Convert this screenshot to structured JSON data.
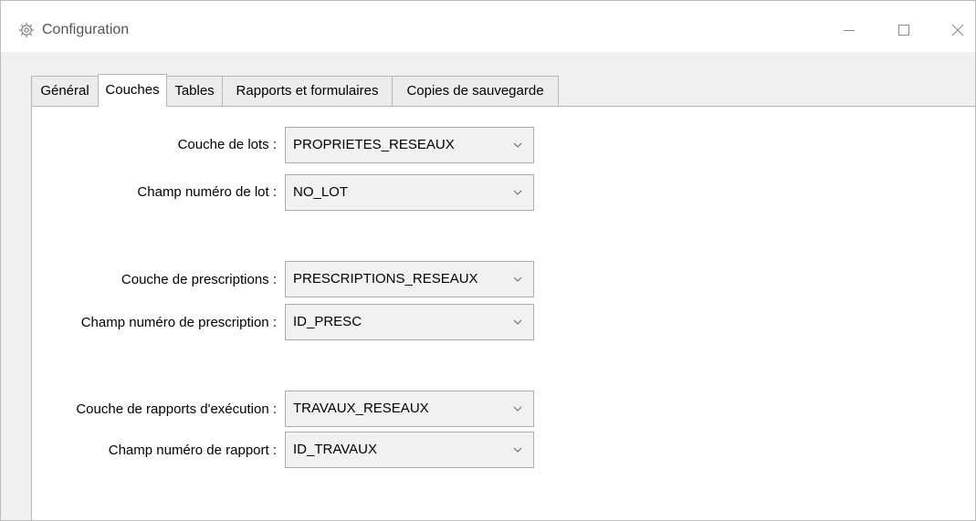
{
  "window": {
    "title": "Configuration",
    "title_icon": "gear-icon"
  },
  "tabs": [
    {
      "label": "Général",
      "active": false
    },
    {
      "label": "Couches",
      "active": true
    },
    {
      "label": "Tables",
      "active": false
    },
    {
      "label": "Rapports et formulaires",
      "active": false
    },
    {
      "label": "Copies de sauvegarde",
      "active": false
    }
  ],
  "fields": {
    "lots_layer": {
      "label": "Couche de lots :",
      "value": "PROPRIETES_RESEAUX"
    },
    "lot_number_field": {
      "label": "Champ numéro de lot :",
      "value": "NO_LOT"
    },
    "prescriptions_layer": {
      "label": "Couche de prescriptions :",
      "value": "PRESCRIPTIONS_RESEAUX"
    },
    "prescription_number_field": {
      "label": "Champ numéro de prescription :",
      "value": "ID_PRESC"
    },
    "reports_layer": {
      "label": "Couche de rapports d'exécution :",
      "value": "TRAVAUX_RESEAUX"
    },
    "report_number_field": {
      "label": "Champ numéro de rapport :",
      "value": "ID_TRAVAUX"
    }
  },
  "colors": {
    "window_bg": "#f0f0f0",
    "panel_bg": "#ffffff",
    "combo_bg": "#f1f1f1",
    "border": "#acacac"
  }
}
